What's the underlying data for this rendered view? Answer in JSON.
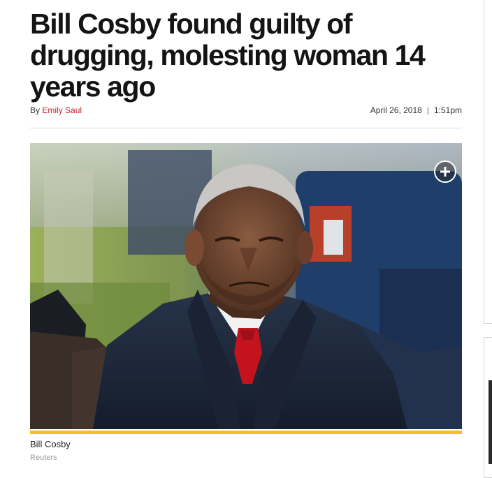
{
  "article": {
    "headline": "Bill Cosby found guilty of drugging, molesting woman 14 years ago",
    "byline_prefix": "By",
    "author": "Emily Saul",
    "date": "April 26, 2018",
    "separator": "|",
    "time": "1:51pm"
  },
  "hero_image": {
    "subject": "Bill Cosby",
    "caption": "Bill Cosby",
    "credit": "Reuters",
    "expand_icon": "plus-circle-icon"
  },
  "colors": {
    "author_link": "#c8202f",
    "caption_bar": "#f4c31a",
    "headline": "#141414"
  }
}
